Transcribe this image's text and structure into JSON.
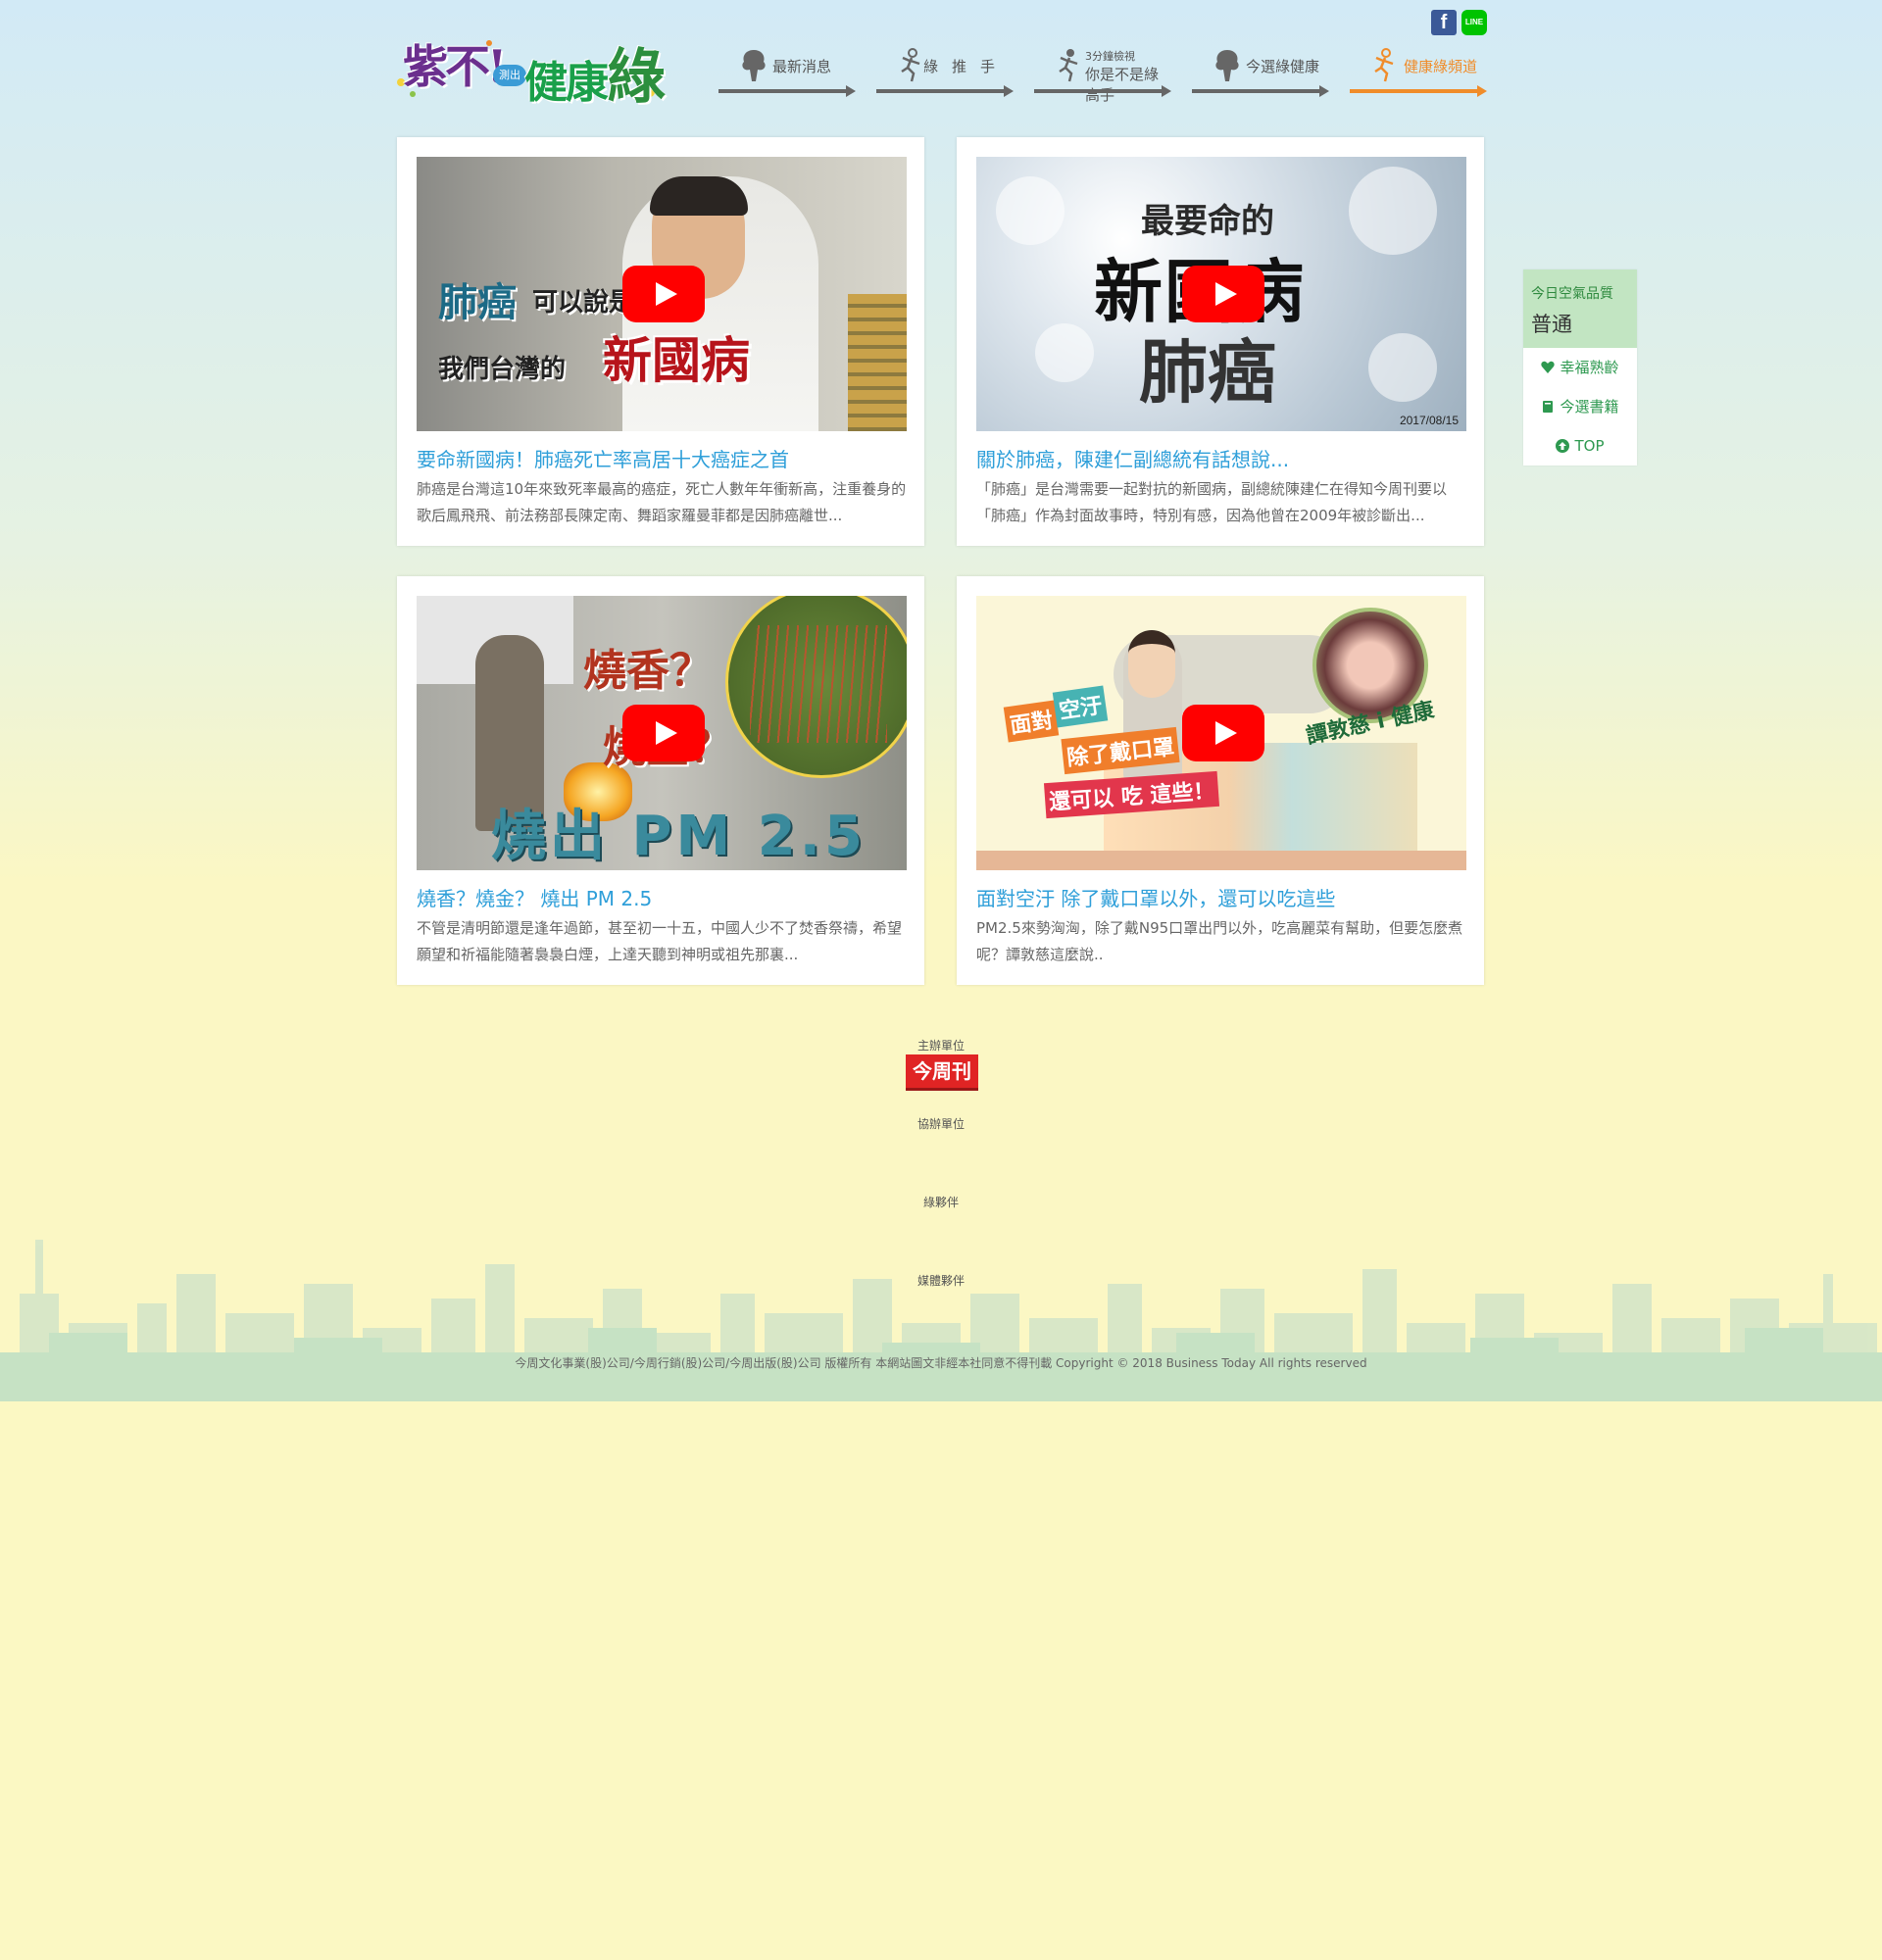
{
  "header": {
    "logo": {
      "part1": "紫不!",
      "badge": "測出",
      "part2": "健康",
      "part3": "綠"
    },
    "nav": [
      {
        "label": "最新消息",
        "icon": "tree-icon"
      },
      {
        "label": "綠推手",
        "icon": "runner-icon"
      },
      {
        "sub": "3分鐘檢視",
        "label": "你是不是綠高手",
        "icon": "runner-icon"
      },
      {
        "label": "今選綠健康",
        "icon": "tree-icon"
      },
      {
        "label": "健康綠頻道",
        "icon": "runner-icon"
      }
    ],
    "social": {
      "facebook": "f",
      "line": "LINE"
    }
  },
  "side": {
    "aq_title": "今日空氣品質",
    "aq_value": "普通",
    "items": [
      {
        "label": "幸福熟齡",
        "icon": "heart-icon"
      },
      {
        "label": "今選書籍",
        "icon": "book-icon"
      },
      {
        "label": "TOP",
        "icon": "up-arrow-icon"
      }
    ]
  },
  "cards": [
    {
      "title": "要命新國病！肺癌死亡率高居十大癌症之首",
      "desc": "肺癌是台灣這10年來致死率最高的癌症，死亡人數年年衝新高，注重養身的歌后鳳飛飛、前法務部長陳定南、舞蹈家羅曼菲都是因肺癌離世...",
      "thumb": {
        "line1a": "肺癌",
        "line1b": "可以說是",
        "line2": "我們台灣的",
        "line3": "新國病"
      }
    },
    {
      "title": "關於肺癌，陳建仁副總統有話想說...",
      "desc": "「肺癌」是台灣需要一起對抗的新國病，副總統陳建仁在得知今周刊要以「肺癌」作為封面故事時，特別有感，因為他曾在2009年被診斷出...",
      "thumb": {
        "line1": "最要命的",
        "line2": "新國病",
        "line3": "肺癌",
        "date": "2017/08/15"
      }
    },
    {
      "title": "燒香？燒金？ 燒出 PM 2.5",
      "desc": "不管是清明節還是逢年過節，甚至初一十五，中國人少不了焚香祭禱，希望願望和祈福能隨著裊裊白煙，上達天聽到神明或祖先那裏...",
      "thumb": {
        "line1": "燒香？",
        "line2": "燒金？",
        "line3": "燒出 PM 2.5"
      }
    },
    {
      "title": "面對空汙 除了戴口罩以外，還可以吃這些",
      "desc": "PM2.5來勢洶洶，除了戴N95口罩出門以外，吃高麗菜有幫助，但要怎麼煮呢？譚敦慈這麼說..",
      "thumb": {
        "l1": "面對",
        "l2": "空汙",
        "l3": "除了戴口罩",
        "l4": "還可以 吃 這些！",
        "name": "譚敦慈 i 健康"
      }
    }
  ],
  "footer": {
    "host_label": "主辦單位",
    "host_logo": "今周刊",
    "co_label": "協辦單位",
    "green_label": "綠夥伴",
    "media_label": "媒體夥伴",
    "copyright": "今周文化事業(股)公司/今周行銷(股)公司/今周出版(股)公司 版權所有 本網站圖文非經本社同意不得刊載 Copyright © 2018 Business Today All rights reserved"
  },
  "colors": {
    "accent_blue": "#2f9fd9",
    "accent_green": "#2e9950",
    "active_orange": "#f08c2a",
    "youtube_red": "#ff0000"
  }
}
